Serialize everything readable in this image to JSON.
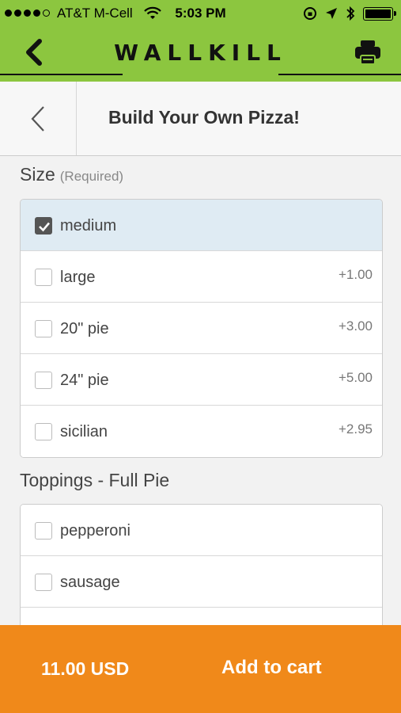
{
  "status_bar": {
    "carrier": "AT&T M-Cell",
    "time": "5:03 PM",
    "icons": [
      "signal-dots",
      "wifi-icon",
      "rotation-lock-icon",
      "location-icon",
      "bluetooth-icon",
      "battery-icon"
    ]
  },
  "app_header": {
    "brand": "WALLKILL",
    "back_icon": "chevron-left-icon",
    "print_icon": "printer-icon",
    "color": "#8cc63f"
  },
  "page_header": {
    "title": "Build Your Own Pizza!",
    "back_icon": "chevron-left-icon"
  },
  "size_section": {
    "label": "Size",
    "required": "(Required)",
    "options": [
      {
        "label": "medium",
        "price": "",
        "checked": true
      },
      {
        "label": "large",
        "price": "+1.00",
        "checked": false
      },
      {
        "label": "20\" pie",
        "price": "+3.00",
        "checked": false
      },
      {
        "label": "24\" pie",
        "price": "+5.00",
        "checked": false
      },
      {
        "label": "sicilian",
        "price": "+2.95",
        "checked": false
      }
    ]
  },
  "toppings_section": {
    "label": "Toppings - Full Pie",
    "options": [
      {
        "label": "pepperoni",
        "price": "",
        "checked": false
      },
      {
        "label": "sausage",
        "price": "",
        "checked": false
      },
      {
        "label": "",
        "price": "",
        "checked": false
      }
    ]
  },
  "cart_bar": {
    "total": "11.00 USD",
    "add_label": "Add to cart",
    "color": "#f0891a"
  }
}
